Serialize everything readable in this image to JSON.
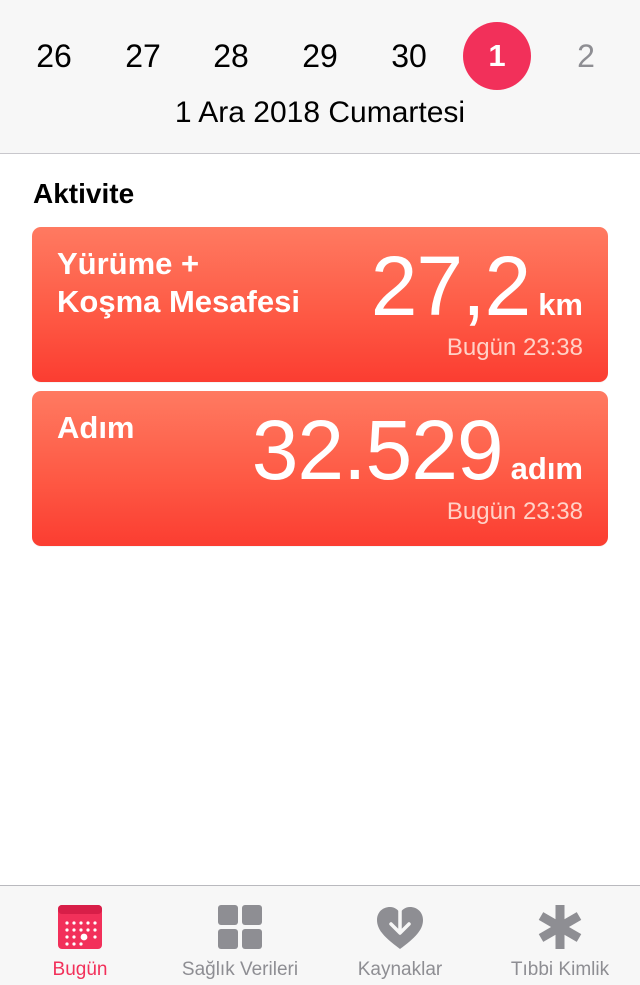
{
  "calendar": {
    "days": [
      {
        "label": "26",
        "state": "normal"
      },
      {
        "label": "27",
        "state": "normal"
      },
      {
        "label": "28",
        "state": "normal"
      },
      {
        "label": "29",
        "state": "normal"
      },
      {
        "label": "30",
        "state": "normal"
      },
      {
        "label": "1",
        "state": "selected"
      },
      {
        "label": "2",
        "state": "future"
      }
    ],
    "selected_date": "1 Ara 2018 Cumartesi",
    "selected_color": "#f2305a"
  },
  "activity": {
    "section_title": "Aktivite",
    "cards": [
      {
        "label_line1": "Yürüme +",
        "label_line2": "Koşma Mesafesi",
        "value": "27,2",
        "unit": "km",
        "time": "Bugün 23:38"
      },
      {
        "label_line1": "Adım",
        "value": "32.529",
        "unit": "adım",
        "time": "Bugün 23:38"
      }
    ],
    "card_color": "#fe5a45"
  },
  "tabbar": {
    "tabs": [
      {
        "label": "Bugün",
        "icon": "calendar-icon",
        "active": true
      },
      {
        "label": "Sağlık Verileri",
        "icon": "grid-icon",
        "active": false
      },
      {
        "label": "Kaynaklar",
        "icon": "heart-download-icon",
        "active": false
      },
      {
        "label": "Tıbbi Kimlik",
        "icon": "asterisk-icon",
        "active": false
      }
    ],
    "active_color": "#f2305a",
    "inactive_color": "#8e8e93"
  }
}
